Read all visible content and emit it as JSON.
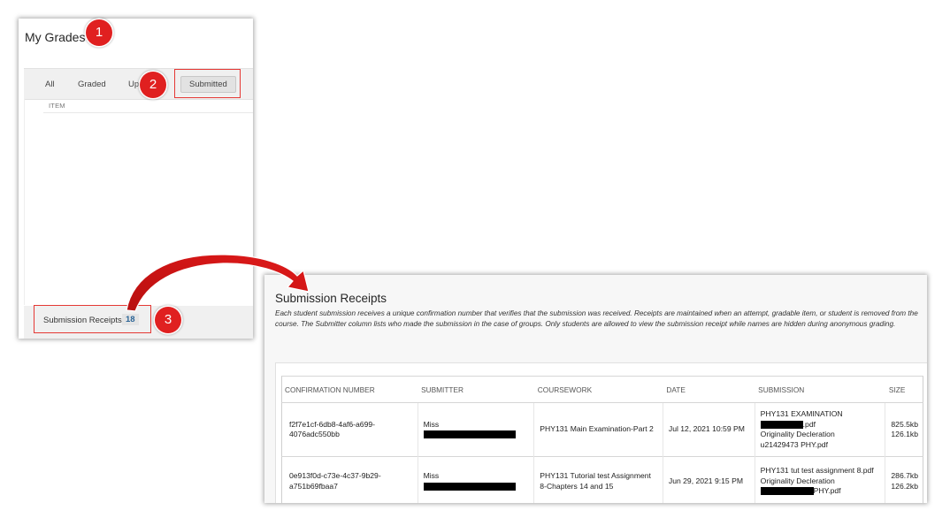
{
  "grades_panel": {
    "title": "My Grades",
    "filters": {
      "all": "All",
      "graded": "Graded",
      "upcoming": "Up",
      "submitted": "Submitted"
    },
    "column_item": "ITEM",
    "footer_label": "Submission Receipts",
    "footer_count": "18"
  },
  "callouts": [
    "1",
    "2",
    "3"
  ],
  "receipts_panel": {
    "title": "Submission Receipts",
    "description": "Each student submission receives a unique confirmation number that verifies that the submission was received. Receipts are maintained when an attempt, gradable item, or student is removed from the course. The Submitter column lists who made the submission in the case of groups. Only students are allowed to view the submission receipt while names are hidden during anonymous grading.",
    "columns": [
      "CONFIRMATION NUMBER",
      "SUBMITTER",
      "COURSEWORK",
      "DATE",
      "SUBMISSION",
      "SIZE"
    ],
    "rows": [
      {
        "confirmation": [
          "f2f7e1cf-6db8-4af6-a699-",
          "4076adc550bb"
        ],
        "submitter": "Miss",
        "coursework": "PHY131 Main Examination-Part 2",
        "date": "Jul 12, 2021 10:59 PM",
        "submission": [
          "PHY131 EXAMINATION",
          ".pdf",
          "Originality Decleration",
          "u21429473 PHY.pdf"
        ],
        "size": [
          "825.5kb",
          "126.1kb"
        ]
      },
      {
        "confirmation": [
          "0e913f0d-c73e-4c37-9b29-",
          "a751b69fbaa7"
        ],
        "submitter": "Miss",
        "coursework": "PHY131 Tutorial test Assignment 8-Chapters 14 and 15",
        "date": "Jun 29, 2021 9:15 PM",
        "submission": [
          "PHY131 tut test assignment 8.pdf",
          "Originality Decleration",
          "PHY.pdf"
        ],
        "size": [
          "286.7kb",
          "126.2kb"
        ]
      }
    ]
  },
  "colors": {
    "callout_red": "#e02020",
    "count_blue": "#2a6496"
  }
}
